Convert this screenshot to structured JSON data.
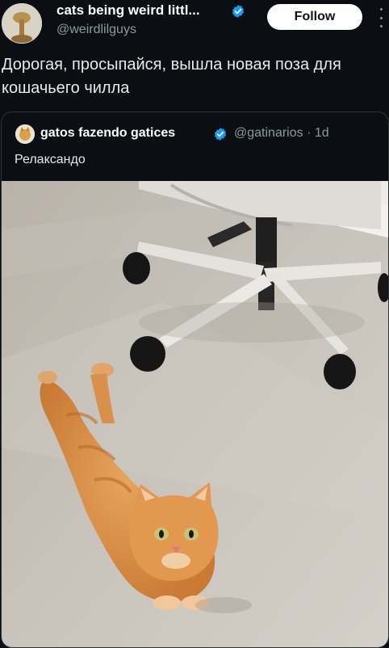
{
  "tweet": {
    "author_name": "cats being weird littl...",
    "handle": "@weirdlilguys",
    "follow_label": "Follow",
    "text": "Дорогая, просыпайся, вышла новая поза для кошачьего чилла"
  },
  "quote": {
    "author_name": "gatos fazendo gatices",
    "meta": "@gatinarios · 1d",
    "text": "Релаксандо"
  },
  "colors": {
    "background": "#0b0f14",
    "verified_badge": "#1d9bf0",
    "secondary_text": "#8b98a5",
    "follow_button": "#ffffff"
  },
  "icons": {
    "verified": "verified-badge-icon",
    "more": "more-options-icon"
  }
}
